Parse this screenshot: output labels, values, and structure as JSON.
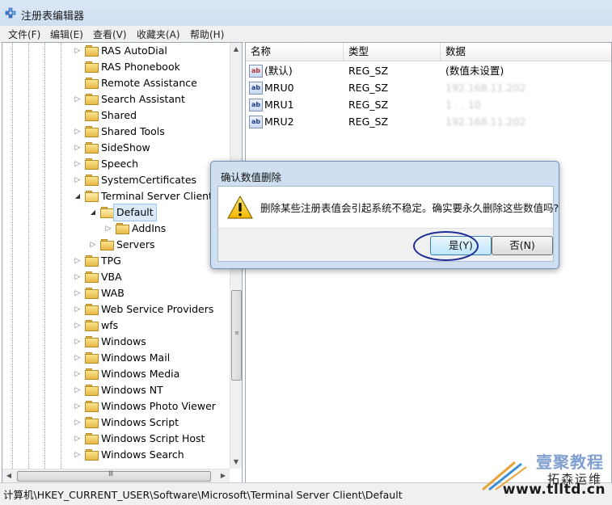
{
  "window": {
    "title": "注册表编辑器"
  },
  "menu": [
    "文件(F)",
    "编辑(E)",
    "查看(V)",
    "收藏夹(A)",
    "帮助(H)"
  ],
  "tree": {
    "items": [
      {
        "label": "RAS AutoDial",
        "level": 0,
        "expand": "collapsed"
      },
      {
        "label": "RAS Phonebook",
        "level": 0,
        "expand": "none"
      },
      {
        "label": "Remote Assistance",
        "level": 0,
        "expand": "none"
      },
      {
        "label": "Search Assistant",
        "level": 0,
        "expand": "collapsed"
      },
      {
        "label": "Shared",
        "level": 0,
        "expand": "none"
      },
      {
        "label": "Shared Tools",
        "level": 0,
        "expand": "collapsed"
      },
      {
        "label": "SideShow",
        "level": 0,
        "expand": "collapsed"
      },
      {
        "label": "Speech",
        "level": 0,
        "expand": "collapsed"
      },
      {
        "label": "SystemCertificates",
        "level": 0,
        "expand": "collapsed"
      },
      {
        "label": "Terminal Server Client",
        "level": 0,
        "expand": "expanded"
      },
      {
        "label": "Default",
        "level": 1,
        "expand": "expanded",
        "selected": true
      },
      {
        "label": "AddIns",
        "level": 2,
        "expand": "collapsed"
      },
      {
        "label": "Servers",
        "level": 1,
        "expand": "collapsed"
      },
      {
        "label": "TPG",
        "level": 0,
        "expand": "collapsed"
      },
      {
        "label": "VBA",
        "level": 0,
        "expand": "collapsed"
      },
      {
        "label": "WAB",
        "level": 0,
        "expand": "collapsed"
      },
      {
        "label": "Web Service Providers",
        "level": 0,
        "expand": "collapsed"
      },
      {
        "label": "wfs",
        "level": 0,
        "expand": "collapsed"
      },
      {
        "label": "Windows",
        "level": 0,
        "expand": "collapsed"
      },
      {
        "label": "Windows Mail",
        "level": 0,
        "expand": "collapsed"
      },
      {
        "label": "Windows Media",
        "level": 0,
        "expand": "collapsed"
      },
      {
        "label": "Windows NT",
        "level": 0,
        "expand": "collapsed"
      },
      {
        "label": "Windows Photo Viewer",
        "level": 0,
        "expand": "collapsed"
      },
      {
        "label": "Windows Script",
        "level": 0,
        "expand": "collapsed"
      },
      {
        "label": "Windows Script Host",
        "level": 0,
        "expand": "collapsed"
      },
      {
        "label": "Windows Search",
        "level": 0,
        "expand": "collapsed"
      }
    ]
  },
  "list": {
    "columns": [
      "名称",
      "类型",
      "数据"
    ],
    "rows": [
      {
        "name": "(默认)",
        "type": "REG_SZ",
        "data": "(数值未设置)",
        "icon": "default-string-value-icon",
        "obscured": false
      },
      {
        "name": "MRU0",
        "type": "REG_SZ",
        "data": "192.168.11.202",
        "icon": "string-value-icon",
        "obscured": true
      },
      {
        "name": "MRU1",
        "type": "REG_SZ",
        "data": "1  .   .   10",
        "icon": "string-value-icon",
        "obscured": true
      },
      {
        "name": "MRU2",
        "type": "REG_SZ",
        "data": "192.168.11.202",
        "icon": "string-value-icon",
        "obscured": true
      }
    ]
  },
  "dialog": {
    "title": "确认数值删除",
    "message": "删除某些注册表值会引起系统不稳定。确实要永久删除这些数值吗?",
    "yes_label": "是(Y)",
    "no_label": "否(N)",
    "icon": "warning-icon",
    "highlight_color": "#1c2c94"
  },
  "status": {
    "path": "计算机\\HKEY_CURRENT_USER\\Software\\Microsoft\\Terminal Server Client\\Default"
  },
  "watermark": {
    "cn_top": "壹聚教程",
    "cn_bottom": "拓森运维",
    "url": "www.tlltd.cn"
  }
}
